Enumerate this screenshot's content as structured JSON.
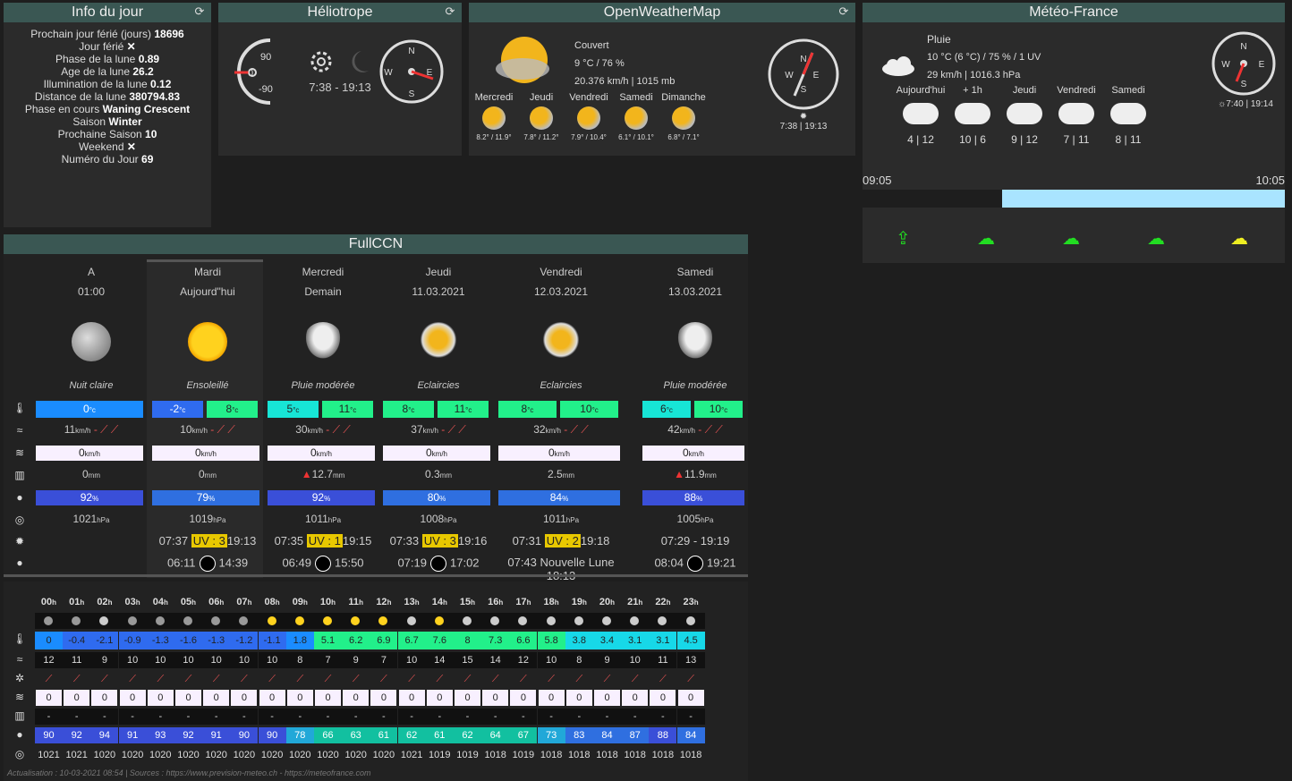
{
  "info": {
    "title": "Info du jour",
    "lines": [
      {
        "label": "Prochain jour férié (jours)",
        "value": "18696"
      },
      {
        "label": "Jour férié",
        "value": "✕",
        "x": true
      },
      {
        "label": "Phase de la lune",
        "value": "0.89"
      },
      {
        "label": "Age de la lune",
        "value": "26.2"
      },
      {
        "label": "Illumination de la lune",
        "value": "0.12"
      },
      {
        "label": "Distance de la lune",
        "value": "380794.83"
      },
      {
        "label": "Phase en cours",
        "value": "Waning Crescent"
      },
      {
        "label": "Saison",
        "value": "Winter"
      },
      {
        "label": "Prochaine Saison",
        "value": "10"
      },
      {
        "label": "Weekend",
        "value": "✕",
        "x": true
      },
      {
        "label": "Numéro du Jour",
        "value": "69"
      }
    ]
  },
  "helio": {
    "title": "Héliotrope",
    "gauge_top": "90",
    "gauge_mid": "0",
    "gauge_bot": "-90",
    "times": "7:38 - 19:13",
    "compass": {
      "n": "N",
      "s": "S",
      "e": "E",
      "w": "W"
    }
  },
  "owm": {
    "title": "OpenWeatherMap",
    "desc": "Couvert",
    "temp_hum": "9 °C / 76 %",
    "wind_press": "20.376 km/h | 1015 mb",
    "sun": "7:38 | 19:13",
    "days": [
      {
        "name": "Mercredi",
        "temps": "8.2° / 11.9°"
      },
      {
        "name": "Jeudi",
        "temps": "7.8° / 11.2°"
      },
      {
        "name": "Vendredi",
        "temps": "7.9° / 10.4°"
      },
      {
        "name": "Samedi",
        "temps": "6.1° / 10.1°"
      },
      {
        "name": "Dimanche",
        "temps": "6.8° / 7.1°"
      }
    ]
  },
  "mf": {
    "title": "Météo-France",
    "desc": "Pluie",
    "line1": "10 °C (6 °C) / 75 % / 1 UV",
    "line2": "29 km/h | 1016.3 hPa",
    "sun": "7:40 | 19:14",
    "days": [
      {
        "name": "Aujourd'hui",
        "temps": "4 | 12"
      },
      {
        "name": "+ 1h",
        "temps": "10 | 6"
      },
      {
        "name": "Jeudi",
        "temps": "9 | 12"
      },
      {
        "name": "Vendredi",
        "temps": "7 | 11"
      },
      {
        "name": "Samedi",
        "temps": "8 | 11"
      }
    ],
    "time_start": "09:05",
    "time_end": "10:05",
    "rain_fraction_dry": 0.33
  },
  "ccn": {
    "title": "FullCCN",
    "cols": [
      {
        "day": "A",
        "sub": "01:00",
        "desc": "Nuit claire",
        "tmin": "0",
        "tmax": "",
        "wind": "11",
        "gust": "0",
        "rain": "0",
        "hum": "92",
        "press": "1021",
        "sun": "",
        "moon": "",
        "icon": "moon"
      },
      {
        "day": "Mardi",
        "sub": "Aujourd\"hui",
        "desc": "Ensoleillé",
        "tmin": "-2",
        "tmax": "8",
        "wind": "10",
        "gust": "0",
        "rain": "0",
        "hum": "79",
        "press": "1019",
        "sun_a": "07:37",
        "uv": "UV : 3",
        "sun_b": "19:13",
        "moon_a": "06:11",
        "moon_b": "14:39",
        "icon": "sun"
      },
      {
        "day": "Mercredi",
        "sub": "Demain",
        "desc": "Pluie modérée",
        "tmin": "5",
        "tmax": "11",
        "wind": "30",
        "gust": "0",
        "rain": "12.7",
        "hum": "92",
        "press": "1011",
        "sun_a": "07:35",
        "uv": "UV : 1",
        "sun_b": "19:15",
        "moon_a": "06:49",
        "moon_b": "15:50",
        "icon": "rain"
      },
      {
        "day": "Jeudi",
        "sub": "11.03.2021",
        "desc": "Eclaircies",
        "tmin": "8",
        "tmax": "11",
        "wind": "37",
        "gust": "0",
        "rain": "0.3",
        "hum": "80",
        "press": "1008",
        "sun_a": "07:33",
        "uv": "UV : 3",
        "sun_b": "19:16",
        "moon_a": "07:19",
        "moon_b": "17:02",
        "icon": "partly"
      },
      {
        "day": "Vendredi",
        "sub": "12.03.2021",
        "desc": "Eclaircies",
        "tmin": "8",
        "tmax": "10",
        "wind": "32",
        "gust": "0",
        "rain": "2.5",
        "hum": "84",
        "press": "1011",
        "sun_a": "07:31",
        "uv": "UV : 2",
        "sun_b": "19:18",
        "moon_a": "07:43 Nouvelle Lune 18:13",
        "moon_b": "",
        "icon": "partly"
      },
      {
        "day": "Samedi",
        "sub": "13.03.2021",
        "desc": "Pluie modérée",
        "tmin": "6",
        "tmax": "10",
        "wind": "42",
        "gust": "0",
        "rain": "11.9",
        "hum": "88",
        "press": "1005",
        "sun_a": "07:29 - 19:19",
        "uv": "",
        "sun_b": "",
        "moon_a": "08:04",
        "moon_b": "19:21",
        "icon": "rain"
      }
    ],
    "units": {
      "c": "°c",
      "kmh": "km/h",
      "mm": "mm",
      "pct": "%",
      "hpa": "hPa"
    }
  },
  "hourly": {
    "hours": [
      "00",
      "01",
      "02",
      "03",
      "04",
      "05",
      "06",
      "07",
      "08",
      "09",
      "10",
      "11",
      "12",
      "13",
      "14",
      "15",
      "16",
      "17",
      "18",
      "19",
      "20",
      "21",
      "22",
      "23"
    ],
    "hour_suffix": "h",
    "temps": [
      "0",
      "-0.4",
      "-2.1",
      "-0.9",
      "-1.3",
      "-1.6",
      "-1.3",
      "-1.2",
      "-1.1",
      "1.8",
      "5.1",
      "6.2",
      "6.9",
      "6.7",
      "7.6",
      "8",
      "7.3",
      "6.6",
      "5.8",
      "3.8",
      "3.4",
      "3.1",
      "3.1",
      "4.5"
    ],
    "wind": [
      "12",
      "11",
      "9",
      "10",
      "10",
      "10",
      "10",
      "10",
      "10",
      "8",
      "7",
      "9",
      "7",
      "10",
      "14",
      "15",
      "14",
      "12",
      "10",
      "8",
      "9",
      "10",
      "11",
      "13"
    ],
    "gust": [
      "0",
      "0",
      "0",
      "0",
      "0",
      "0",
      "0",
      "0",
      "0",
      "0",
      "0",
      "0",
      "0",
      "0",
      "0",
      "0",
      "0",
      "0",
      "0",
      "0",
      "0",
      "0",
      "0",
      "0"
    ],
    "rain": [
      "-",
      "-",
      "-",
      "-",
      "-",
      "-",
      "-",
      "-",
      "-",
      "-",
      "-",
      "-",
      "-",
      "-",
      "-",
      "-",
      "-",
      "-",
      "-",
      "-",
      "-",
      "-",
      "-",
      "-"
    ],
    "hum": [
      "90",
      "92",
      "94",
      "91",
      "93",
      "92",
      "91",
      "90",
      "90",
      "78",
      "66",
      "63",
      "61",
      "62",
      "61",
      "62",
      "64",
      "67",
      "73",
      "83",
      "84",
      "87",
      "88",
      "84"
    ],
    "press": [
      "1021",
      "1021",
      "1020",
      "1020",
      "1020",
      "1020",
      "1020",
      "1020",
      "1020",
      "1020",
      "1020",
      "1020",
      "1020",
      "1021",
      "1019",
      "1019",
      "1018",
      "1019",
      "1018",
      "1018",
      "1018",
      "1018",
      "1018",
      "1018"
    ],
    "icons": [
      "moon",
      "moon",
      "cloud",
      "moon",
      "moon",
      "moon",
      "moon",
      "moon",
      "sun",
      "sun",
      "sun",
      "sun",
      "sun",
      "cloud",
      "sun",
      "cloud",
      "cloud",
      "cloud",
      "cloud",
      "cloud",
      "cloud",
      "cloud",
      "cloud",
      "cloud"
    ],
    "footer": "Actualisation : 10-03-2021 08:54 | Sources : https://www.prevision-meteo.ch - https://meteofrance.com"
  }
}
